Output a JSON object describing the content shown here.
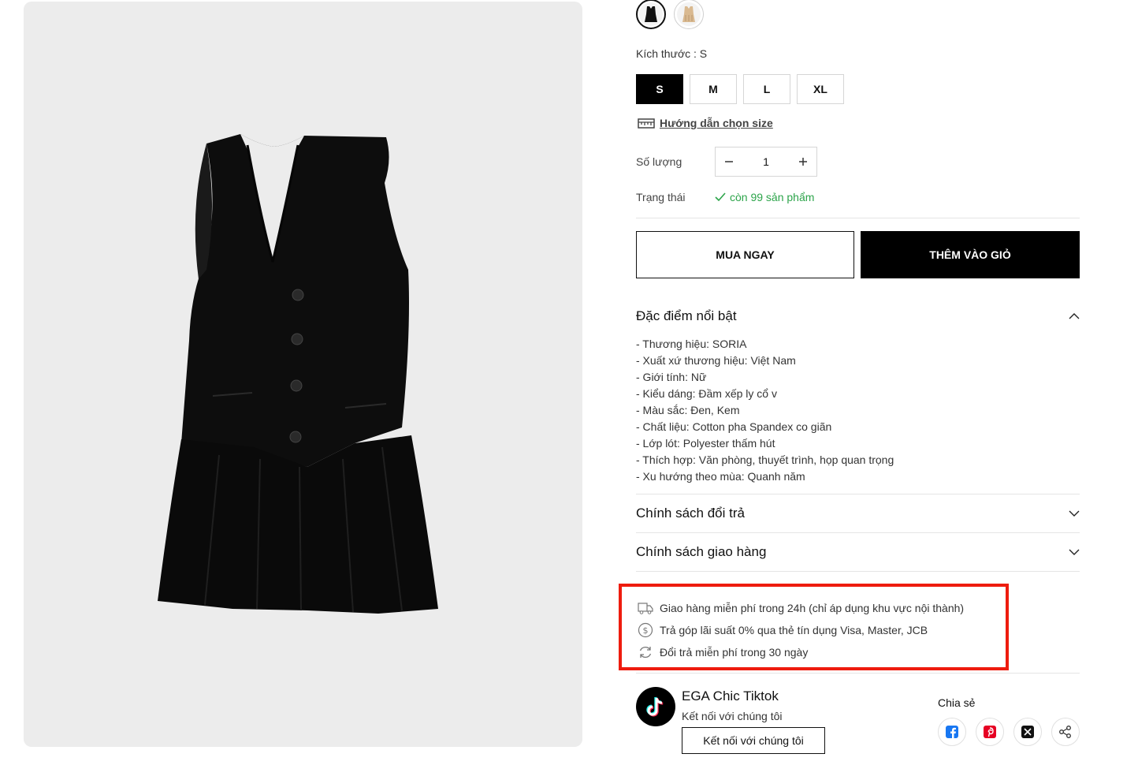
{
  "product": {
    "colors": [
      {
        "name": "black-dress-swatch",
        "selected": true,
        "color": "#111111"
      },
      {
        "name": "cream-dress-swatch",
        "selected": false,
        "color": "#e6cdb0"
      }
    ],
    "size_label": "Kích thước : S",
    "sizes": [
      "S",
      "M",
      "L",
      "XL"
    ],
    "selected_size": "S",
    "size_guide": "Hướng dẫn chọn size",
    "quantity_label": "Số lượng",
    "quantity": "1",
    "status_label": "Trạng thái",
    "status_value": "còn 99 sản phẩm",
    "buy_now": "MUA NGAY",
    "add_to_cart": "THÊM VÀO GIỎ"
  },
  "accordions": {
    "features_title": "Đặc điểm nổi bật",
    "features": [
      "- Thương hiệu: SORIA",
      "- Xuất xứ thương hiệu: Việt Nam",
      "- Giới tính: Nữ",
      "- Kiểu dáng: Đầm xếp ly cổ v",
      "- Màu sắc: Đen, Kem",
      "- Chất liệu: Cotton pha Spandex co giãn",
      "- Lớp lót: Polyester thấm hút",
      "- Thích hợp: Văn phòng, thuyết trình, họp quan trọng",
      "- Xu hướng theo mùa: Quanh năm"
    ],
    "return_title": "Chính sách đổi trả",
    "shipping_title": "Chính sách giao hàng"
  },
  "perks": [
    {
      "icon": "delivery-truck-icon",
      "text": "Giao hàng miễn phí trong 24h (chỉ áp dụng khu vực nội thành)"
    },
    {
      "icon": "dollar-circle-icon",
      "text": "Trả góp lãi suất 0% qua thẻ tín dụng Visa, Master, JCB"
    },
    {
      "icon": "refresh-icon",
      "text": "Đổi trả miễn phí trong 30 ngày"
    }
  ],
  "social": {
    "title": "EGA Chic Tiktok",
    "subtitle": "Kết nối với chúng tôi",
    "button": "Kết nối với chúng tôi",
    "share_label": "Chia sẻ",
    "share_icons": [
      "facebook-icon",
      "pinterest-icon",
      "x-twitter-icon",
      "share-icon"
    ]
  },
  "colors": {
    "accent": "#000000",
    "success": "#2ca44a",
    "highlight_border": "#ee1c0e",
    "facebook": "#1877f2",
    "pinterest": "#e60023"
  }
}
